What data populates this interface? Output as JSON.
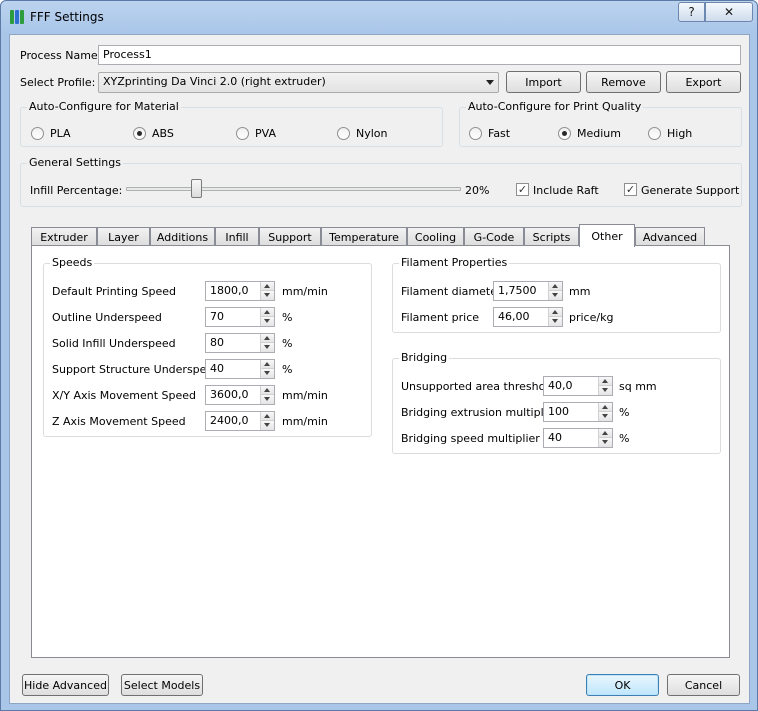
{
  "window": {
    "title": "FFF Settings",
    "help_label": "?",
    "close_label": "✕"
  },
  "process": {
    "label": "Process Name:",
    "value": "Process1"
  },
  "profile": {
    "label": "Select Profile:",
    "selected": "XYZprinting Da Vinci 2.0 (right extruder)",
    "import_label": "Import",
    "remove_label": "Remove",
    "export_label": "Export"
  },
  "material": {
    "title": "Auto-Configure for Material",
    "options": [
      "PLA",
      "ABS",
      "PVA",
      "Nylon"
    ],
    "selected": "ABS"
  },
  "quality": {
    "title": "Auto-Configure for Print Quality",
    "options": [
      "Fast",
      "Medium",
      "High"
    ],
    "selected": "Medium"
  },
  "general": {
    "title": "General Settings",
    "infill_label": "Infill Percentage:",
    "infill_value": "20%",
    "infill_level": 20,
    "include_raft_label": "Include Raft",
    "include_raft_checked": true,
    "generate_support_label": "Generate Support",
    "generate_support_checked": true
  },
  "tabs": [
    "Extruder",
    "Layer",
    "Additions",
    "Infill",
    "Support",
    "Temperature",
    "Cooling",
    "G-Code",
    "Scripts",
    "Other",
    "Advanced"
  ],
  "active_tab": "Other",
  "speeds": {
    "title": "Speeds",
    "rows": [
      {
        "label": "Default Printing Speed",
        "value": "1800,0",
        "unit": "mm/min"
      },
      {
        "label": "Outline Underspeed",
        "value": "70",
        "unit": "%"
      },
      {
        "label": "Solid Infill Underspeed",
        "value": "80",
        "unit": "%"
      },
      {
        "label": "Support Structure Underspeed",
        "value": "40",
        "unit": "%"
      },
      {
        "label": "X/Y Axis Movement Speed",
        "value": "3600,0",
        "unit": "mm/min"
      },
      {
        "label": "Z Axis Movement Speed",
        "value": "2400,0",
        "unit": "mm/min"
      }
    ]
  },
  "filament": {
    "title": "Filament Properties",
    "rows": [
      {
        "label": "Filament diameter",
        "value": "1,7500",
        "unit": "mm"
      },
      {
        "label": "Filament price",
        "value": "46,00",
        "unit": "price/kg"
      }
    ]
  },
  "bridging": {
    "title": "Bridging",
    "rows": [
      {
        "label": "Unsupported area threshold",
        "value": "40,0",
        "unit": "sq mm"
      },
      {
        "label": "Bridging extrusion multiplier",
        "value": "100",
        "unit": "%"
      },
      {
        "label": "Bridging speed multiplier",
        "value": "40",
        "unit": "%"
      }
    ]
  },
  "footer": {
    "hide_advanced_label": "Hide Advanced",
    "select_models_label": "Select Models",
    "ok_label": "OK",
    "cancel_label": "Cancel"
  }
}
